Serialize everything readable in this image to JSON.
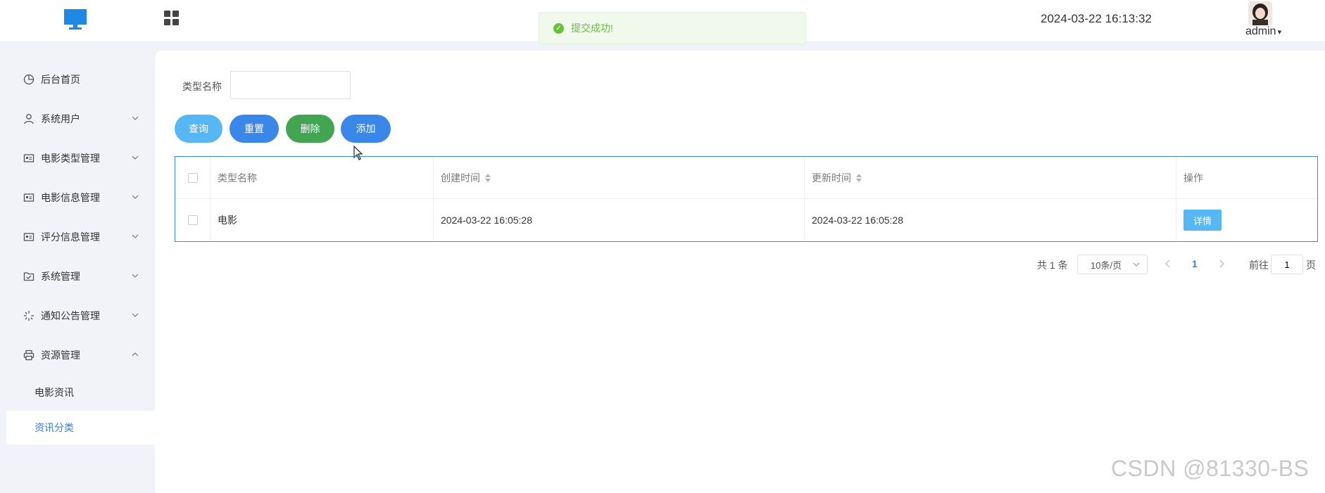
{
  "header": {
    "datetime": "2024-03-22 16:13:32",
    "user_name": "admin",
    "user_caret": "▾"
  },
  "toast": {
    "message": "提交成功!",
    "type": "success",
    "icon": "check-circle-icon"
  },
  "sidebar": {
    "items": [
      {
        "label": "后台首页",
        "icon": "pie-chart-icon"
      },
      {
        "label": "系统用户",
        "icon": "user-icon"
      },
      {
        "label": "电影类型管理",
        "icon": "id-card-icon"
      },
      {
        "label": "电影信息管理",
        "icon": "id-card-icon"
      },
      {
        "label": "评分信息管理",
        "icon": "id-card-icon"
      },
      {
        "label": "系统管理",
        "icon": "folder-check-icon"
      },
      {
        "label": "通知公告管理",
        "icon": "loading-icon"
      },
      {
        "label": "资源管理",
        "icon": "printer-icon"
      }
    ],
    "sub_items": [
      {
        "label": "电影资讯"
      },
      {
        "label": "资讯分类"
      }
    ],
    "active_sub": "资讯分类"
  },
  "search": {
    "label": "类型名称",
    "value": "",
    "placeholder": ""
  },
  "buttons": {
    "query": "查询",
    "reset": "重置",
    "delete": "删除",
    "add": "添加"
  },
  "table": {
    "columns": [
      "类型名称",
      "创建时间",
      "更新时间",
      "操作"
    ],
    "rows": [
      {
        "name": "电影",
        "created": "2024-03-22 16:05:28",
        "updated": "2024-03-22 16:05:28",
        "action": "详情"
      }
    ]
  },
  "pagination": {
    "total": "共 1 条",
    "page_size": "10条/页",
    "current_page": "1",
    "goto_label": "前往",
    "goto_value": "1",
    "page_suffix": "页"
  },
  "watermark": "CSDN @81330-BS",
  "colors": {
    "primary": "#3a87ea",
    "info": "#55b8f4",
    "success": "#41a552",
    "sidebar_bg": "#f1f3f8"
  }
}
